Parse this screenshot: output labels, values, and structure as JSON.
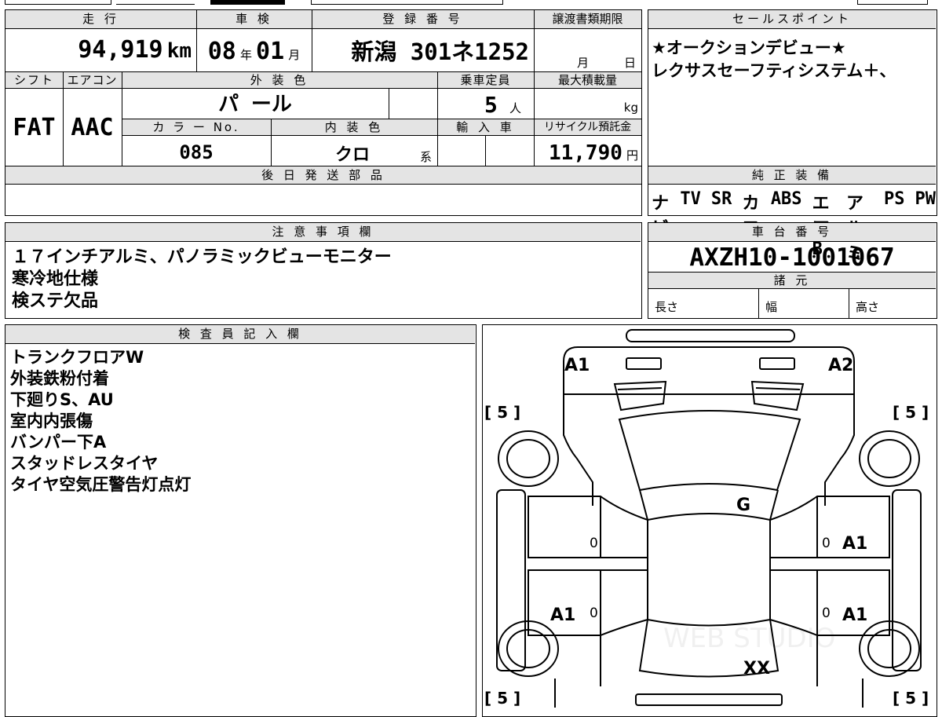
{
  "top_strip": {
    "partial_text": ""
  },
  "vehicle": {
    "headers": {
      "mileage": "走 行",
      "inspection": "車 検",
      "registration": "登 録 番 号",
      "transfer_deadline": "譲渡書類期限",
      "shift": "シフト",
      "aircon": "エアコン",
      "exterior_color": "外 装 色",
      "capacity": "乗車定員",
      "max_load": "最大積載量",
      "color_no": "カ ラ ー No.",
      "interior_color": "内 装 色",
      "import": "輸 入 車",
      "recycle_fee": "リサイクル預託金",
      "later_parts": "後 日 発 送 部 品"
    },
    "mileage_value": "94,919",
    "mileage_unit": "km",
    "inspection_year": "08",
    "year_unit": "年",
    "inspection_month": "01",
    "month_unit": "月",
    "registration_number": "新潟 301ネ1252",
    "deadline_month_unit": "月",
    "deadline_day_unit": "日",
    "shift_value": "FAT",
    "aircon_value": "AAC",
    "exterior_color_value": "パ ール",
    "capacity_value": "5",
    "capacity_unit": "人",
    "max_load_unit": "kg",
    "color_no_value": "085",
    "interior_color_value": "クロ",
    "interior_suffix": "系",
    "recycle_value": "11,790",
    "recycle_unit": "円"
  },
  "sales_points": {
    "header": "セールスポイント",
    "lines": [
      "★オークションデビュー★",
      "レクサスセーフティシステム＋、"
    ]
  },
  "genuine_equipment": {
    "header": "純 正 装 備",
    "items": [
      "ナビ",
      "TV",
      "SR",
      "カワ",
      "ABS",
      "エアB",
      "アルミ",
      "PS",
      "PW"
    ]
  },
  "notes": {
    "header": "注 意 事 項 欄",
    "lines": [
      "１７インチアルミ、パノラミックビューモニター",
      "寒冷地仕様",
      "検ステ欠品"
    ]
  },
  "chassis": {
    "header": "車 台 番 号",
    "number": "AXZH10-1001067",
    "spec_header": "諸 元",
    "length_label": "長さ",
    "width_label": "幅",
    "height_label": "高さ"
  },
  "inspector": {
    "header": "検 査 員 記 入 欄",
    "lines": [
      "トランクフロアW",
      "外装鉄粉付着",
      "下廻りS、AU",
      "室内内張傷",
      "バンパー下A",
      "スタッドレスタイヤ",
      "タイヤ空気圧警告灯点灯"
    ]
  },
  "diagram": {
    "mark_front_left": "A1",
    "mark_front_right": "A2",
    "mark_hood": "G",
    "mark_front_door_right": "A1",
    "mark_rear_door_left": "A1",
    "mark_rear_door_right": "A1",
    "mark_trunk": "XX",
    "door_zero": "0",
    "tread_fl": "[ 5 ]",
    "tread_fr": "[ 5 ]",
    "tread_rl": "[ 5 ]",
    "tread_rr": "[ 5 ]",
    "watermark": "WEB STUDIO"
  }
}
